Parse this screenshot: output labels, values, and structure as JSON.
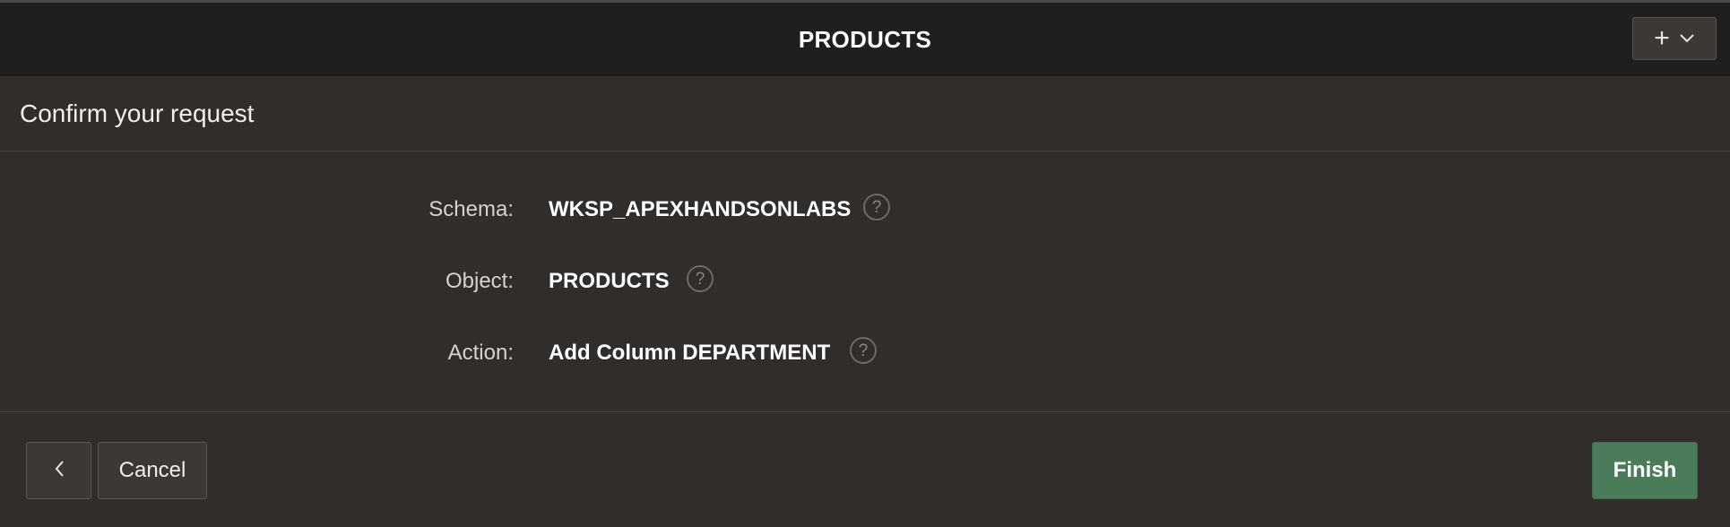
{
  "header": {
    "title": "PRODUCTS",
    "add_menu_icon": "plus-icon",
    "add_menu_chevron_icon": "chevron-down-icon"
  },
  "subheader": {
    "title": "Confirm your request"
  },
  "details": [
    {
      "label": "Schema:",
      "value": "WKSP_APEXHANDSONLABS",
      "help": "?"
    },
    {
      "label": "Object:",
      "value": "PRODUCTS",
      "help": "?"
    },
    {
      "label": "Action:",
      "value": "Add Column DEPARTMENT",
      "help": "?"
    }
  ],
  "footer": {
    "back_icon": "chevron-left-icon",
    "cancel_label": "Cancel",
    "finish_label": "Finish"
  },
  "colors": {
    "background": "#312d2a",
    "header_background": "#201f1d",
    "finish_button": "#4a7c59"
  }
}
